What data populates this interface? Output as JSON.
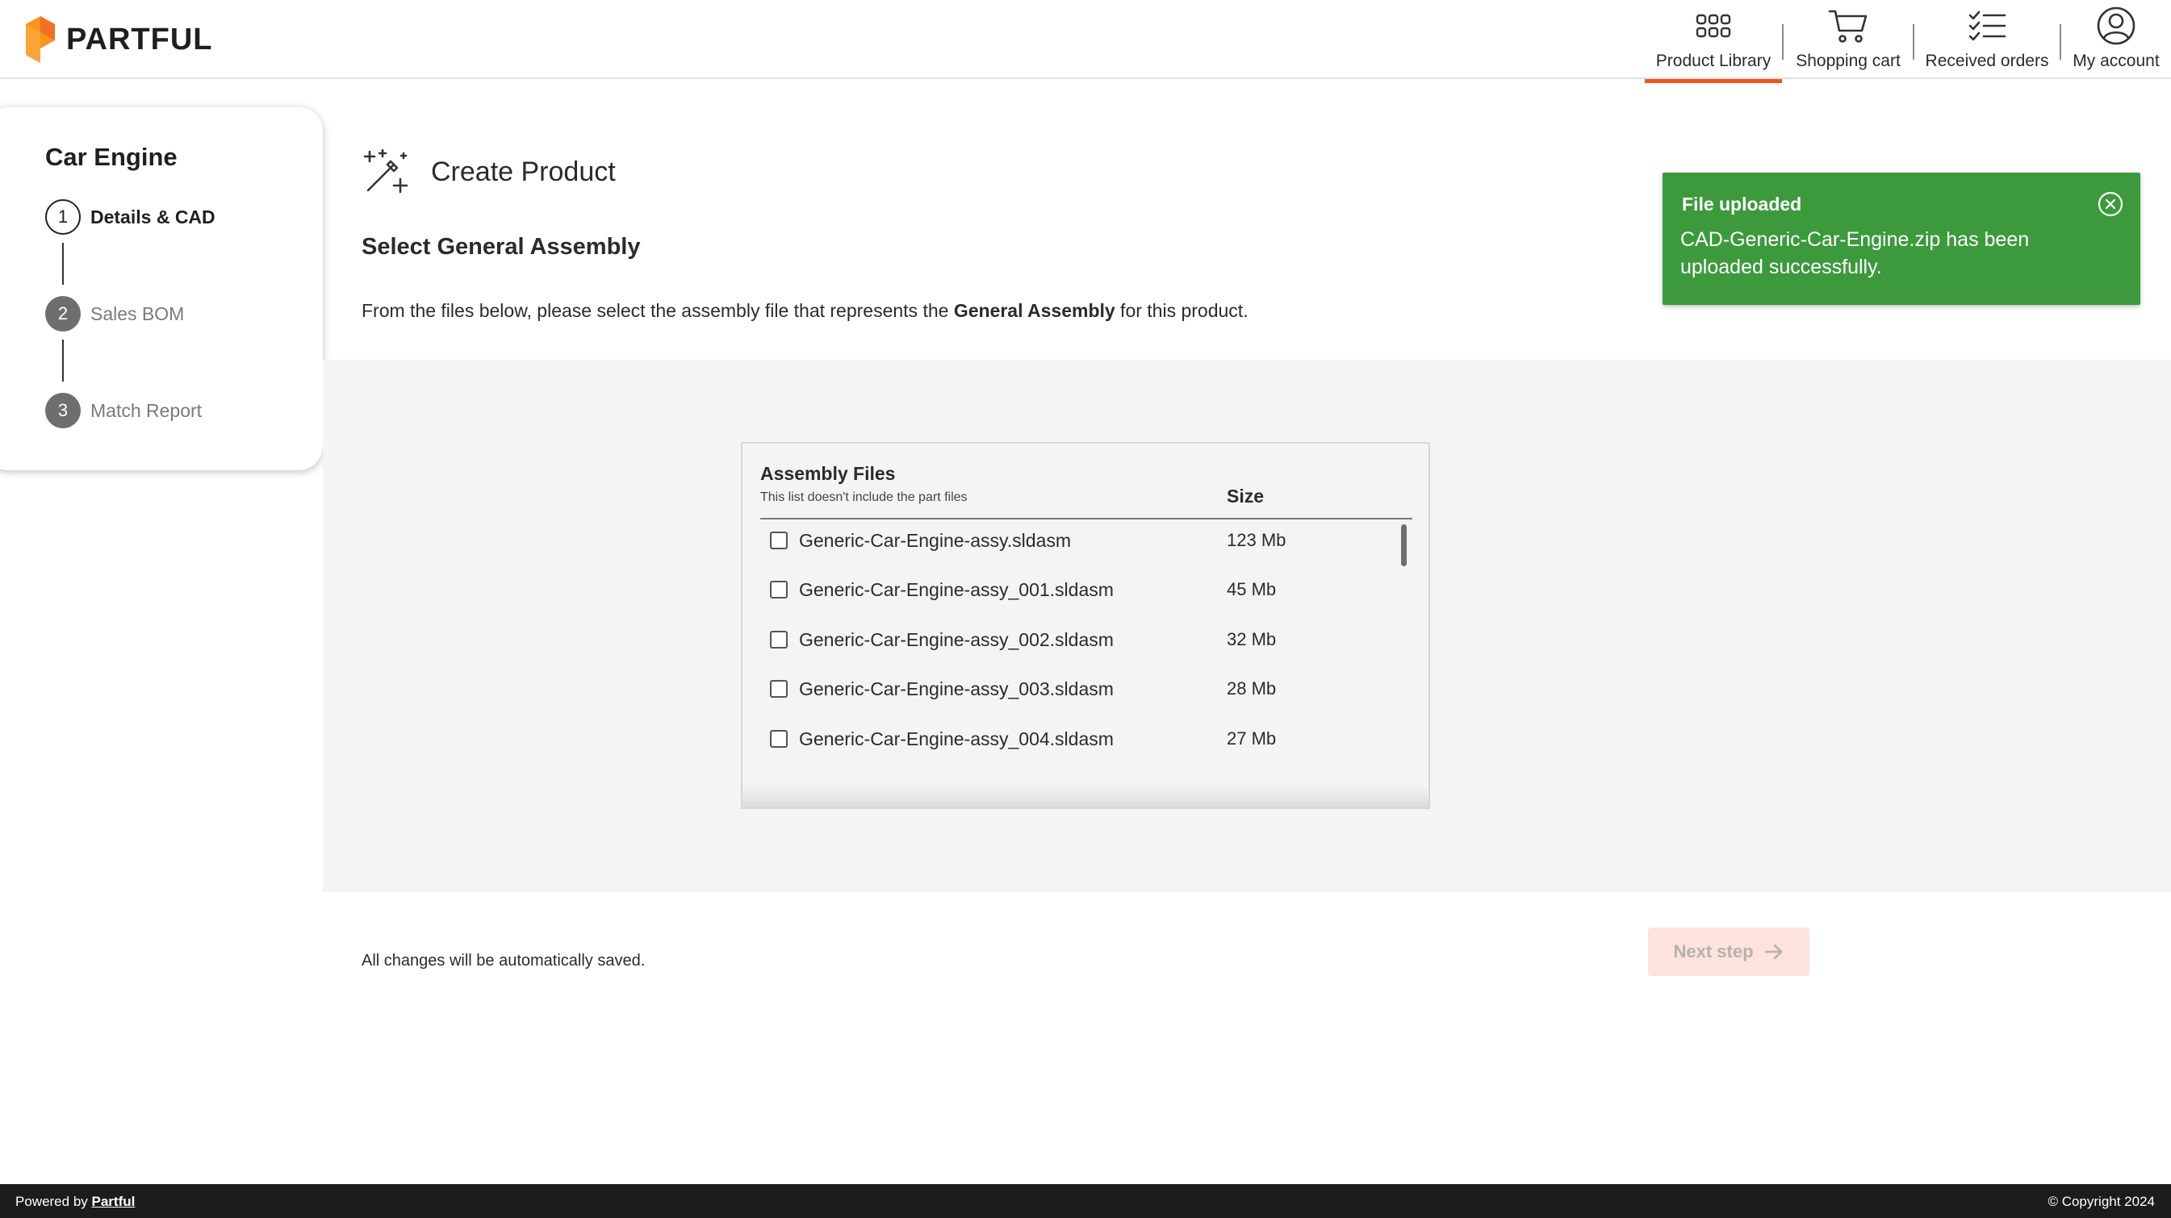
{
  "app": {
    "brand": "PARTFUL",
    "accent_color": "#f0541e"
  },
  "nav": {
    "items": [
      {
        "label": "Product Library",
        "icon": "grid-icon",
        "active": true
      },
      {
        "label": "Shopping cart",
        "icon": "cart-icon",
        "active": false
      },
      {
        "label": "Received orders",
        "icon": "checklist-icon",
        "active": false
      },
      {
        "label": "My account",
        "icon": "user-circle-icon",
        "active": false
      }
    ]
  },
  "stepper": {
    "title": "Car Engine",
    "steps": [
      {
        "number": "1",
        "label": "Details & CAD",
        "state": "current"
      },
      {
        "number": "2",
        "label": "Sales BOM",
        "state": "pending"
      },
      {
        "number": "3",
        "label": "Match Report",
        "state": "pending"
      }
    ]
  },
  "main": {
    "page_title": "Create Product",
    "section_title": "Select General Assembly",
    "instructions_before": "From the files below, please select the assembly file that represents the ",
    "instructions_bold": "General Assembly",
    "instructions_after": " for this product."
  },
  "files": {
    "title": "Assembly Files",
    "subtitle": "This list doesn't include the part files",
    "size_header": "Size",
    "rows": [
      {
        "name": "Generic-Car-Engine-assy.sldasm",
        "size": "123 Mb",
        "checked": false
      },
      {
        "name": "Generic-Car-Engine-assy_001.sldasm",
        "size": "45 Mb",
        "checked": false
      },
      {
        "name": "Generic-Car-Engine-assy_002.sldasm",
        "size": "32 Mb",
        "checked": false
      },
      {
        "name": "Generic-Car-Engine-assy_003.sldasm",
        "size": "28 Mb",
        "checked": false
      },
      {
        "name": "Generic-Car-Engine-assy_004.sldasm",
        "size": "27 Mb",
        "checked": false
      }
    ]
  },
  "footer": {
    "autosave": "All changes will be automatically saved.",
    "next_label": "Next step",
    "powered_by": "Powered by",
    "powered_link": "Partful",
    "copyright": "© Copyright 2024"
  },
  "toast": {
    "title": "File uploaded",
    "message": "CAD-Generic-Car-Engine.zip has been uploaded successfully.",
    "color": "#3c9a3d"
  }
}
